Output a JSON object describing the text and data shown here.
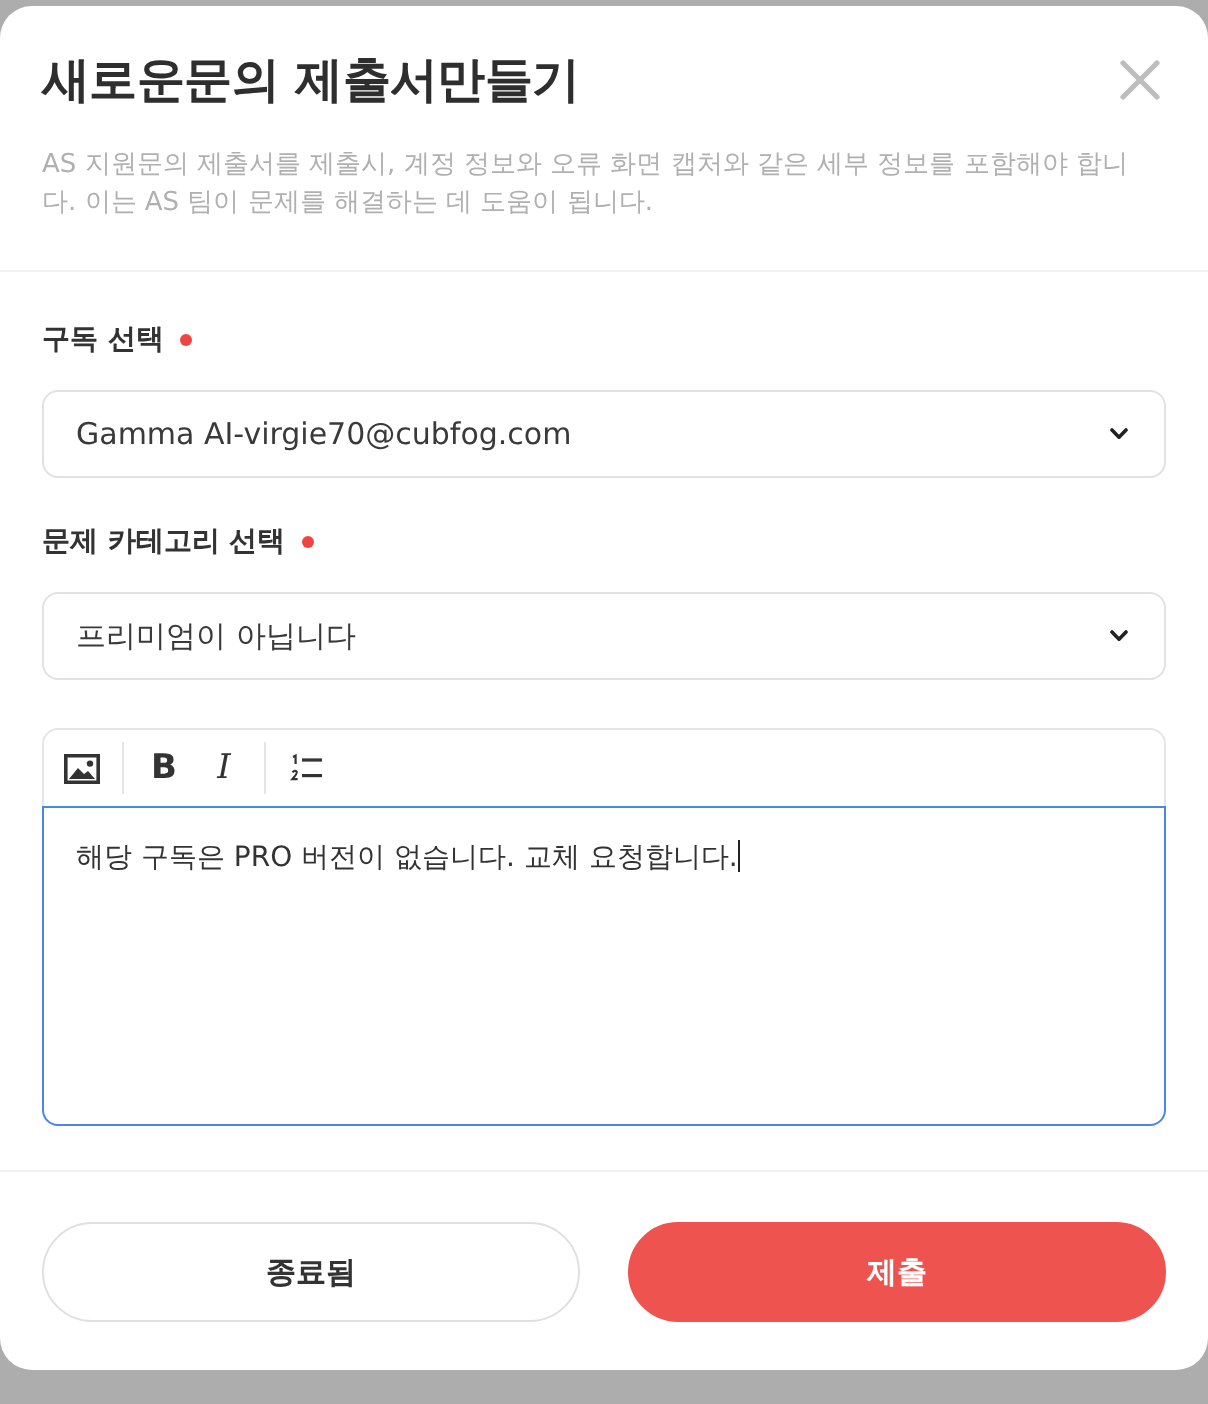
{
  "dialog": {
    "title": "새로운문의 제출서만들기",
    "description": "AS 지원문의 제출서를 제출시, 계정 정보와 오류 화면 캡처와 같은 세부 정보를 포함해야 합니다. 이는 AS 팀이 문제를 해결하는 데 도움이 됩니다."
  },
  "fields": [
    {
      "label": "구독 선택",
      "required": true,
      "value": "Gamma AI-virgie70@cubfog.com"
    },
    {
      "label": "문제 카테고리 선택",
      "required": true,
      "value": "프리미엄이 아닙니다"
    }
  ],
  "editor": {
    "toolbar": [
      {
        "kind": "image"
      },
      {
        "kind": "bold",
        "text": "B"
      },
      {
        "kind": "italic",
        "text": "I"
      },
      {
        "kind": "ordered-list"
      }
    ],
    "value": "해당 구독은 PRO 버전이 없습니다. 교체 요청합니다.",
    "focused": true
  },
  "buttons": [
    {
      "label": "종료됨",
      "kind": "secondary"
    },
    {
      "label": "제출",
      "kind": "primary"
    }
  ]
}
